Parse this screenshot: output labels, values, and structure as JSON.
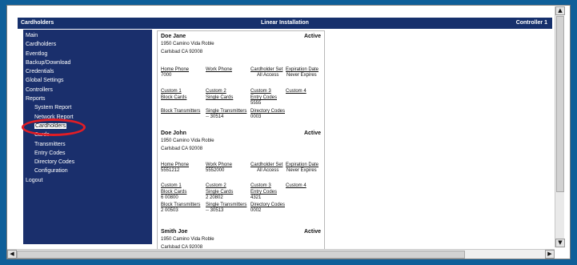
{
  "header": {
    "left": "Cardholders",
    "center": "Linear Installation",
    "right": "Controller 1"
  },
  "sidebar": {
    "items": [
      {
        "label": "Main"
      },
      {
        "label": "Cardholders"
      },
      {
        "label": "Eventlog"
      },
      {
        "label": "Backup/Download"
      },
      {
        "label": "Credentials"
      },
      {
        "label": "Global Settings"
      },
      {
        "label": "Controllers"
      },
      {
        "label": "Reports"
      },
      {
        "label": "System Report"
      },
      {
        "label": "Network Report"
      },
      {
        "label": "Cardholders"
      },
      {
        "label": "Cards"
      },
      {
        "label": "Transmitters"
      },
      {
        "label": "Entry Codes"
      },
      {
        "label": "Directory Codes"
      },
      {
        "label": "Configuration"
      },
      {
        "label": "Logout"
      }
    ]
  },
  "labels": {
    "home_phone": "Home Phone",
    "work_phone": "Work Phone",
    "cardholder_set": "Cardholder Set",
    "expiration_date": "Expiration Date",
    "custom1": "Custom 1",
    "custom2": "Custom 2",
    "custom3": "Custom 3",
    "custom4": "Custom 4",
    "block_cards": "Block Cards",
    "single_cards": "Single Cards",
    "entry_codes": "Entry Codes",
    "block_transmitters": "Block Transmitters",
    "single_transmitters": "Single Transmitters",
    "directory_codes": "Directory Codes"
  },
  "records": [
    {
      "name": "Doe Jane",
      "status": "Active",
      "address1": "1950 Camino Vida Roble",
      "address2": "Carlsbad CA 92008",
      "home_phone": "7000",
      "work_phone": "",
      "cardholder_set": "All Access",
      "expiration_date": "Never Expires",
      "block_cards": "",
      "single_cards": "",
      "entry_codes": "5555",
      "block_transmitters": "",
      "single_transmitters": "-- 30514",
      "directory_codes": "0003"
    },
    {
      "name": "Doe John",
      "status": "Active",
      "address1": "1950 Camino Vida Roble",
      "address2": "Carlsbad CA 92008",
      "home_phone": "5551212",
      "work_phone": "5552000",
      "cardholder_set": "All Access",
      "expiration_date": "Never Expires",
      "block_cards": "6 00800",
      "single_cards": "2 20802",
      "entry_codes": "4321",
      "block_transmitters": "2 00503",
      "single_transmitters": "-- 30513",
      "directory_codes": "0002"
    },
    {
      "name": "Smith Joe",
      "status": "Active",
      "address1": "1950 Camino Vida Roble",
      "address2": "Carlsbad CA 92008"
    }
  ],
  "annotation_color": "#e11d25"
}
